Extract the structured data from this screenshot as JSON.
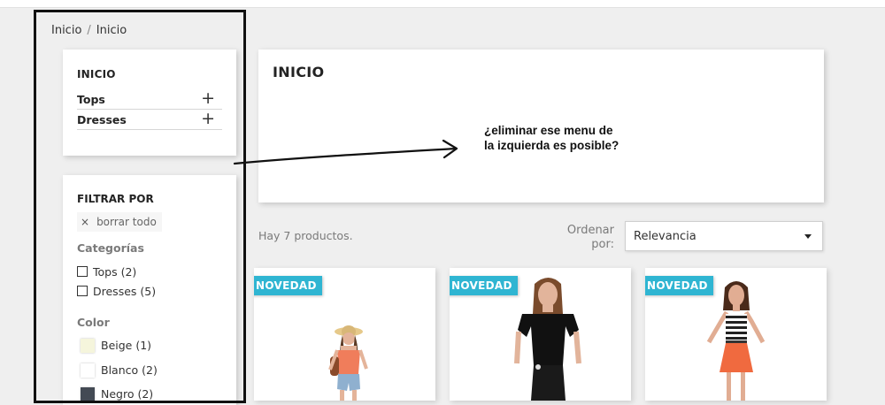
{
  "breadcrumb": [
    "Inicio",
    "Inicio"
  ],
  "breadcrumb_separator": "/",
  "categories_block": {
    "title": "INICIO",
    "items": [
      {
        "label": "Tops",
        "toggle": "+"
      },
      {
        "label": "Dresses",
        "toggle": "+"
      }
    ]
  },
  "filters": {
    "title": "FILTRAR POR",
    "clear_icon": "×",
    "clear_label": "borrar todo",
    "category_facet": {
      "title": "Categorías",
      "options": [
        "Tops (2)",
        "Dresses (5)"
      ]
    },
    "color_facet": {
      "title": "Color",
      "options": [
        {
          "label": "Beige (1)",
          "color": "#f5f5dc"
        },
        {
          "label": "Blanco (2)",
          "color": "#ffffff"
        },
        {
          "label": "Negro (2)",
          "color": "#434a54"
        }
      ]
    }
  },
  "main": {
    "title": "INICIO",
    "annotation": "¿eliminar ese menu de la izquierda es posible?"
  },
  "listing": {
    "count_text": "Hay 7 productos.",
    "sort_label": "Ordenar por:",
    "sort_value": "Relevancia"
  },
  "products": [
    {
      "badge": "NOVEDAD"
    },
    {
      "badge": "NOVEDAD"
    },
    {
      "badge": "NOVEDAD"
    }
  ],
  "colors": {
    "accent": "#2fb5d2",
    "background": "#efefef",
    "outline": "#111111"
  }
}
